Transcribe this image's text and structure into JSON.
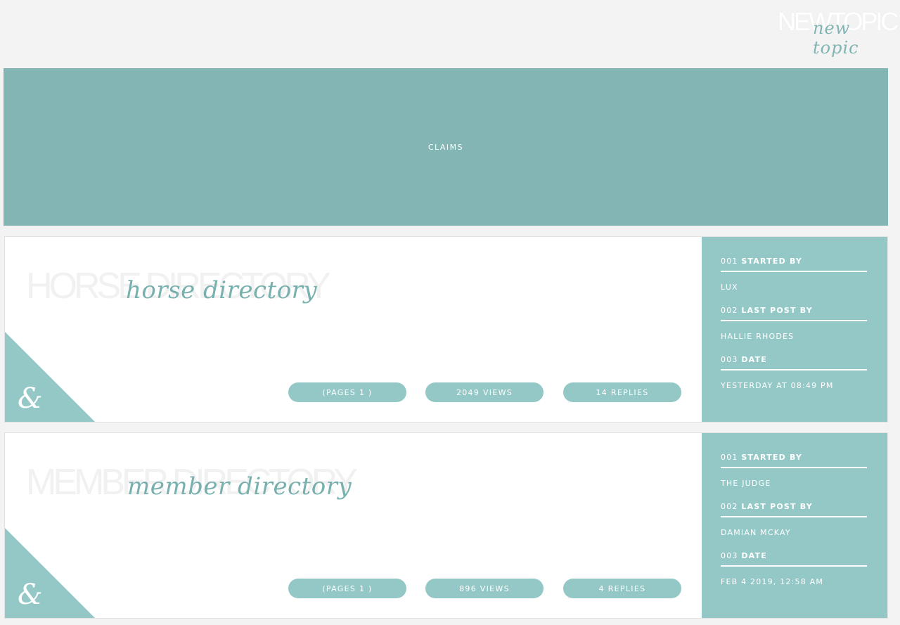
{
  "new_topic": {
    "big_text": "NEWTOPIC",
    "script_text": "new topic"
  },
  "claims": {
    "label": "CLAIMS"
  },
  "topics": [
    {
      "ghost_title": "HORSE DIRECTORY",
      "title": "horse directory",
      "corner_glyph": "&",
      "pages": "(PAGES 1 )",
      "views": "2049 VIEWS",
      "replies": "14 REPLIES",
      "started_num": "001",
      "started_label": "STARTED BY",
      "started_by": "LUX",
      "last_num": "002",
      "last_label": "LAST POST BY",
      "last_post_by": "HALLIE RHODES",
      "date_num": "003",
      "date_label": "DATE",
      "date": "YESTERDAY AT 08:49 PM"
    },
    {
      "ghost_title": "MEMBER DIRECTORY",
      "title": "member directory",
      "corner_glyph": "&",
      "pages": "(PAGES 1 )",
      "views": "896 VIEWS",
      "replies": "4 REPLIES",
      "started_num": "001",
      "started_label": "STARTED BY",
      "started_by": "THE JUDGE",
      "last_num": "002",
      "last_label": "LAST POST BY",
      "last_post_by": "DAMIAN MCKAY",
      "date_num": "003",
      "date_label": "DATE",
      "date": "FEB 4 2019, 12:58 AM"
    }
  ],
  "colors": {
    "background": "#f3f3f3",
    "banner": "#82b5b3",
    "accent": "#93c8c6",
    "script": "#78b0ae"
  }
}
